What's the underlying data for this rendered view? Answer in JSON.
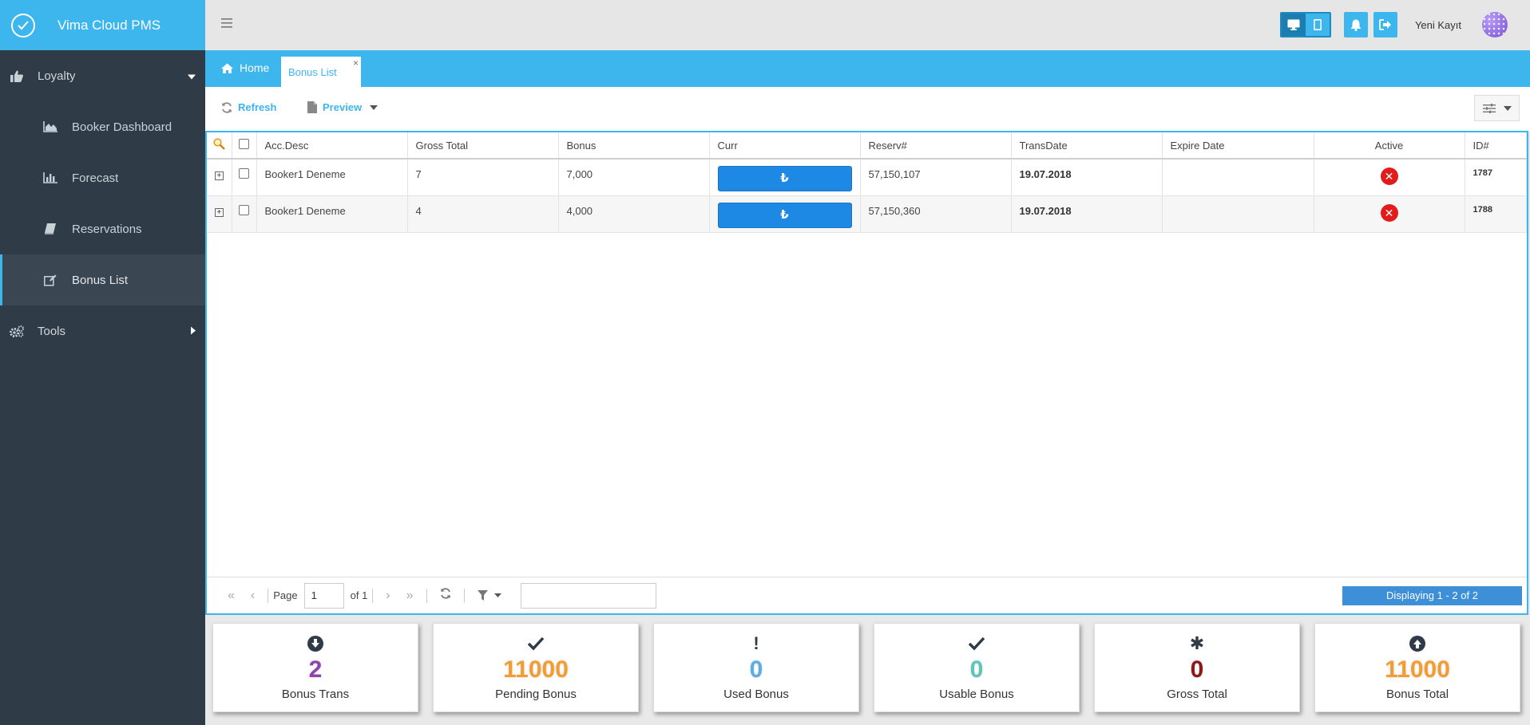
{
  "app": {
    "title": "Vima Cloud PMS"
  },
  "sidebar": {
    "groups": [
      {
        "label": "Loyalty",
        "icon": "thumbs-up-icon",
        "expanded": true
      },
      {
        "label": "Tools",
        "icon": "gears-icon",
        "expanded": false
      }
    ],
    "items": [
      {
        "label": "Booker Dashboard",
        "icon": "area-chart-icon"
      },
      {
        "label": "Forecast",
        "icon": "bar-chart-icon"
      },
      {
        "label": "Reservations",
        "icon": "book-icon"
      },
      {
        "label": "Bonus List",
        "icon": "edit-icon",
        "active": true
      }
    ]
  },
  "header": {
    "user_name": "Yeni Kayıt"
  },
  "tabs": {
    "home": "Home",
    "active": "Bonus List",
    "close": "×"
  },
  "toolbar": {
    "refresh": "Refresh",
    "preview": "Preview"
  },
  "grid": {
    "columns": [
      "Acc.Desc",
      "Gross Total",
      "Bonus",
      "Curr",
      "Reserv#",
      "TransDate",
      "Expire Date",
      "Active",
      "ID#"
    ],
    "rows": [
      {
        "acc_desc": "Booker1 Deneme",
        "gross_total": "7",
        "bonus": "7,000",
        "curr": "₺",
        "reserv": "57,150,107",
        "trans_date": "19.07.2018",
        "expire_date": "",
        "active": "✕",
        "id": "1787"
      },
      {
        "acc_desc": "Booker1 Deneme",
        "gross_total": "4",
        "bonus": "4,000",
        "curr": "₺",
        "reserv": "57,150,360",
        "trans_date": "19.07.2018",
        "expire_date": "",
        "active": "✕",
        "id": "1788"
      }
    ]
  },
  "pager": {
    "page_label": "Page",
    "page_value": "1",
    "of_label": "of 1",
    "display_info": "Displaying 1 - 2 of 2"
  },
  "stats": [
    {
      "icon": "arrow-circle-down-icon",
      "value": "2",
      "label": "Bonus Trans",
      "color": "#8e44ad"
    },
    {
      "icon": "check-icon",
      "value": "11000",
      "label": "Pending Bonus",
      "color": "#f39c33"
    },
    {
      "icon": "exclamation-icon",
      "glyph": "!",
      "value": "0",
      "label": "Used Bonus",
      "color": "#5dade2"
    },
    {
      "icon": "check-icon",
      "value": "0",
      "label": "Usable Bonus",
      "color": "#5fc5b8"
    },
    {
      "icon": "asterisk-icon",
      "glyph": "✱",
      "value": "0",
      "label": "Gross Total",
      "color": "#8b1a1a"
    },
    {
      "icon": "arrow-circle-up-icon",
      "value": "11000",
      "label": "Bonus Total",
      "color": "#f39c33"
    }
  ],
  "colors": {
    "accent": "#3db6ee",
    "sidebar": "#2f3b46",
    "button_blue": "#1e88e5",
    "danger": "#e21b1b"
  }
}
